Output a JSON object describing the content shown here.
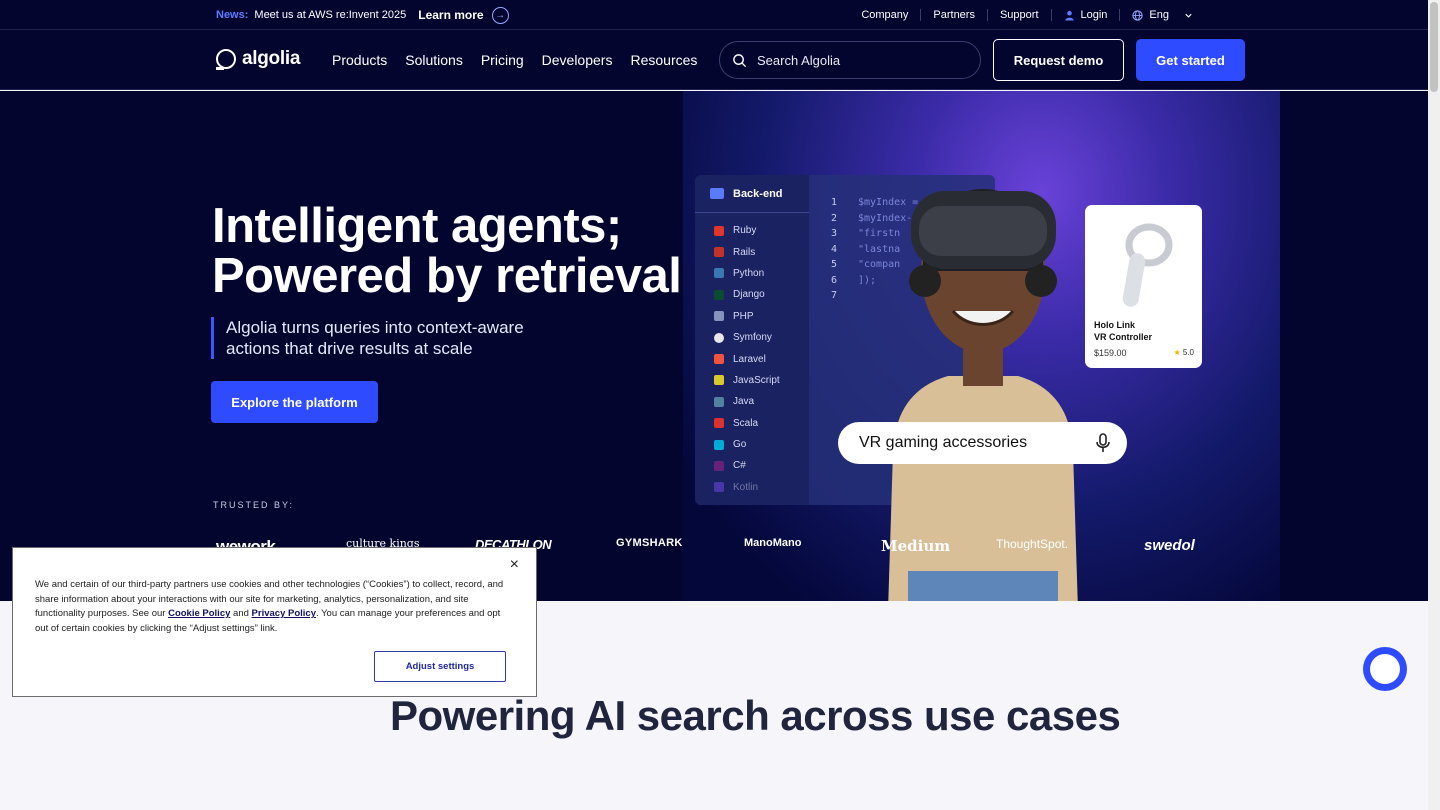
{
  "newsbar": {
    "tag": "News:",
    "text": "Meet us at AWS re:Invent 2025",
    "link": "Learn more",
    "utility": [
      "Company",
      "Partners",
      "Support",
      "Login",
      "Eng"
    ]
  },
  "nav": {
    "logo": "algolia",
    "items": [
      "Products",
      "Solutions",
      "Pricing",
      "Developers",
      "Resources"
    ],
    "search_placeholder": "Search Algolia",
    "demo_label": "Request demo",
    "start_label": "Get started"
  },
  "hero": {
    "title_line1": "Intelligent agents;",
    "title_line2": "Powered by retrieval",
    "subtitle": "Algolia turns queries into context-aware actions that drive results at scale",
    "cta": "Explore the platform",
    "trusted": "TRUSTED BY:"
  },
  "visual": {
    "panel_title": "Back-end",
    "languages": [
      "Ruby",
      "Rails",
      "Python",
      "Django",
      "PHP",
      "Symfony",
      "Laravel",
      "JavaScript",
      "Java",
      "Scala",
      "Go",
      "C#",
      "Kotlin"
    ],
    "line_numbers": [
      "1",
      "2",
      "3",
      "4",
      "5",
      "6",
      "7"
    ],
    "code": [
      "$myIndex = ",
      "$myIndex->",
      "  \"firstn",
      "  \"lastna",
      "  \"compan",
      "]);",
      ""
    ],
    "product_name_1": "Holo Link",
    "product_name_2": "VR Controller",
    "product_price": "$159.00",
    "product_rating": "5.0",
    "voice_query": "VR gaming accessories"
  },
  "brands": [
    "wework",
    "culture kings",
    "DECATHLON",
    "GYMSHARK",
    "ManoMano",
    "Medium",
    "ThoughtSpot.",
    "swedol"
  ],
  "lower": {
    "title": "Powering AI search across use cases"
  },
  "cookie": {
    "text_1": "We and certain of our third-party partners use cookies and other technologies (“Cookies”) to collect, record, and share information about your interactions with our site for marketing, analytics, personalization, and site functionality purposes. See our ",
    "cookie_policy": "Cookie Policy",
    "and": " and ",
    "privacy_policy": "Privacy Policy",
    "text_2": ". You can manage your preferences and opt out of certain cookies by clicking the “Adjust settings” link.",
    "close": "×",
    "button": "Adjust settings"
  },
  "colors": {
    "navy": "#03052e",
    "accent": "#2f4bff",
    "news_tag": "#5d7cff"
  }
}
